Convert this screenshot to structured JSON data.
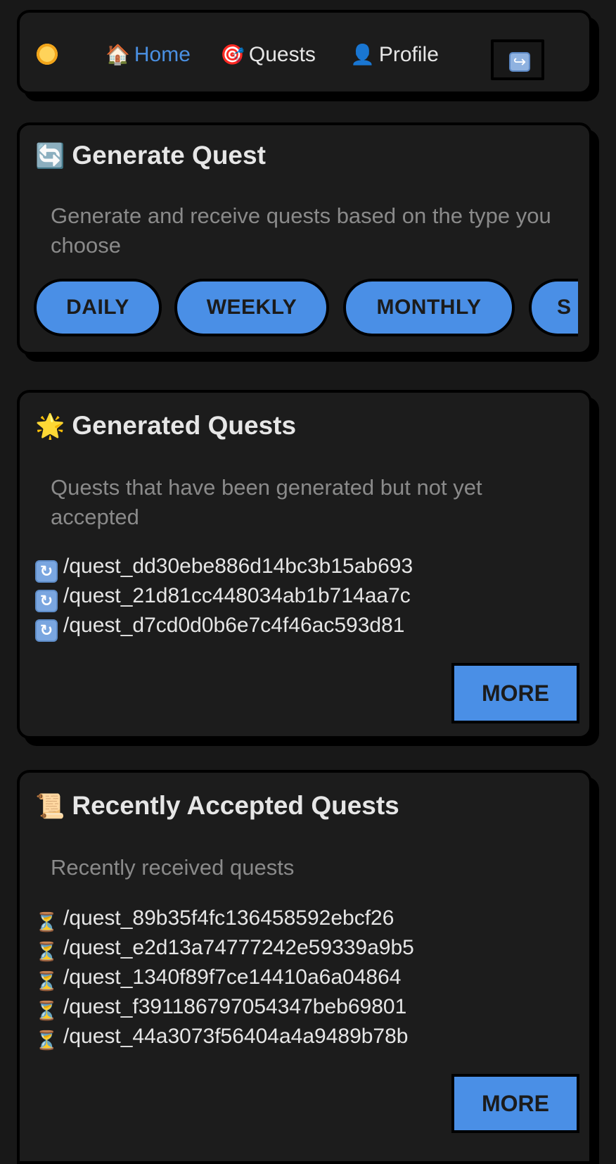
{
  "nav": {
    "items": [
      {
        "emoji": "🏠",
        "label": "Home"
      },
      {
        "emoji": "🎯",
        "label": "Quests"
      },
      {
        "emoji": "👤",
        "label": "Profile"
      }
    ],
    "logout_icon_glyph": "↪",
    "active_color": "#4a90e2"
  },
  "generate": {
    "icon": "🔄",
    "title": "Generate Quest",
    "description": "Generate and receive quests based on the type you choose",
    "types": [
      "DAILY",
      "WEEKLY",
      "MONTHLY",
      "S"
    ]
  },
  "generated": {
    "icon": "🌟",
    "title": "Generated Quests",
    "description": "Quests that have been generated but not yet accepted",
    "item_icon": "🔄",
    "items": [
      "/quest_dd30ebe886d14bc3b15ab693",
      "/quest_21d81cc448034ab1b714aa7c",
      "/quest_d7cd0d0b6e7c4f46ac593d81"
    ],
    "more_label": "MORE"
  },
  "accepted": {
    "icon": "📜",
    "title": "Recently Accepted Quests",
    "description": "Recently received quests",
    "item_icon": "⏳",
    "items": [
      "/quest_89b35f4fc136458592ebcf26",
      "/quest_e2d13a74777242e59339a9b5",
      "/quest_1340f89f7ce14410a6a04864",
      "/quest_f391186797054347beb69801",
      "/quest_44a3073f56404a4a9489b78b"
    ],
    "more_label": "MORE"
  },
  "colors": {
    "accent": "#4a8fe6",
    "background": "#181818",
    "muted_text": "#8a8a8a"
  }
}
